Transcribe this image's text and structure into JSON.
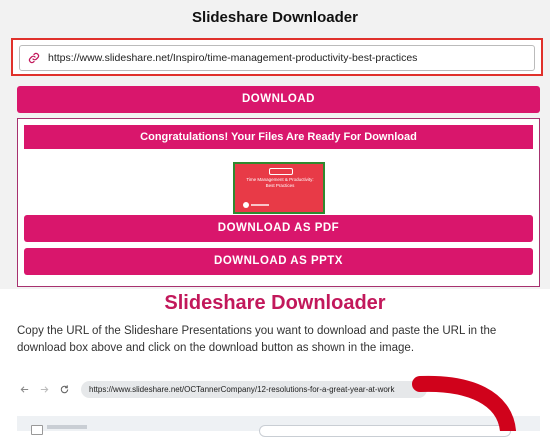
{
  "app": {
    "title": "Slideshare Downloader"
  },
  "url_input": {
    "value": "https://www.slideshare.net/Inspiro/time-management-productivity-best-practices"
  },
  "buttons": {
    "download": "DOWNLOAD",
    "download_pdf": "DOWNLOAD AS PDF",
    "download_pptx": "DOWNLOAD AS PPTX"
  },
  "result": {
    "message": "Congratulations! Your Files Are Ready For Download",
    "thumbnail": {
      "title": "Time Management & Productivity: Best Practices"
    }
  },
  "section": {
    "title": "Slideshare Downloader",
    "description": "Copy the URL of the Slideshare Presentations you want to download and paste the URL in the download box above and click on the download button as shown in the image."
  },
  "browser": {
    "address": "https://www.slideshare.net/OCTannerCompany/12-resolutions-for-a-great-year-at-work"
  },
  "colors": {
    "accent": "#d9166c",
    "highlight_border": "#e0312b",
    "section_title": "#c2185b",
    "thumbnail_bg": "#e83a47",
    "arrow": "#d0021b"
  },
  "icons": [
    "link-icon",
    "back-arrow-icon",
    "forward-arrow-icon",
    "reload-icon"
  ]
}
